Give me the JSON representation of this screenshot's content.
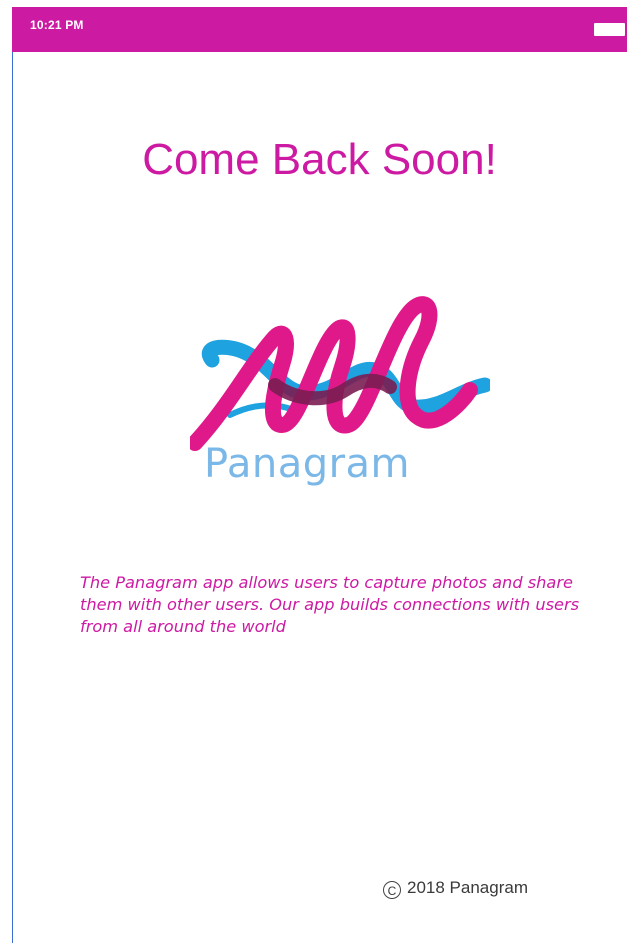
{
  "status_bar": {
    "time": "10:21 PM",
    "battery_icon": "battery-icon"
  },
  "title": "Come Back Soon!",
  "logo": {
    "wordmark": "Panagram",
    "colors": {
      "magenta": "#e0198a",
      "blue": "#1fa2e0",
      "overlap": "#7a1d52",
      "wordmark": "#7bb8e8"
    }
  },
  "description": "The Panagram  app allows users to capture photos and share them with other users. Our app builds connections with users from all around the world",
  "footer": {
    "copyright_icon": "copyright-icon",
    "copyright_symbol": "C",
    "text": "2018 Panagram"
  },
  "colors": {
    "accent": "#cc1aa3",
    "status_bar": "#cc1aa3",
    "text_dark": "#3a3a3a"
  }
}
